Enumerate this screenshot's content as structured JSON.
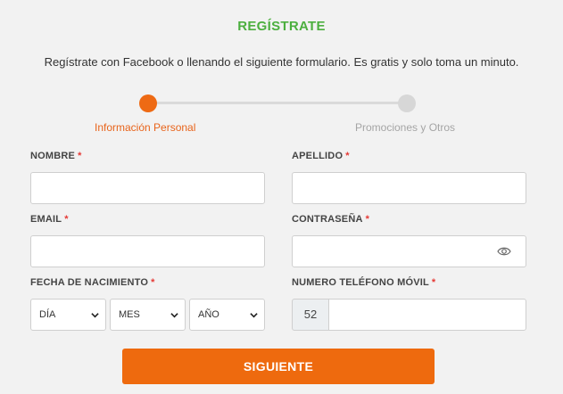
{
  "header": {
    "title": "REGÍSTRATE",
    "subtitle": "Regístrate con Facebook o llenando el siguiente formulario. Es gratis y solo toma un minuto."
  },
  "stepper": {
    "steps": [
      {
        "label": "Información Personal",
        "state": "active"
      },
      {
        "label": "Promociones y Otros",
        "state": "inactive"
      }
    ]
  },
  "form": {
    "required_mark": "*",
    "first_name": {
      "label": "NOMBRE",
      "value": ""
    },
    "last_name": {
      "label": "APELLIDO",
      "value": ""
    },
    "email": {
      "label": "EMAIL",
      "value": ""
    },
    "password": {
      "label": "CONTRASEÑA",
      "value": "",
      "icon": "eye-icon"
    },
    "birthdate": {
      "label": "FECHA DE NACIMIENTO",
      "day": "DÍA",
      "month": "MES",
      "year": "AÑO"
    },
    "phone": {
      "label": "NUMERO TELÉFONO MÓVIL",
      "prefix": "52",
      "value": ""
    }
  },
  "actions": {
    "next_label": "SIGUIENTE"
  },
  "colors": {
    "title_green": "#4caf3f",
    "accent_orange": "#ee6a0e",
    "required_red": "#e53935",
    "inactive_gray": "#d7d7d7"
  }
}
